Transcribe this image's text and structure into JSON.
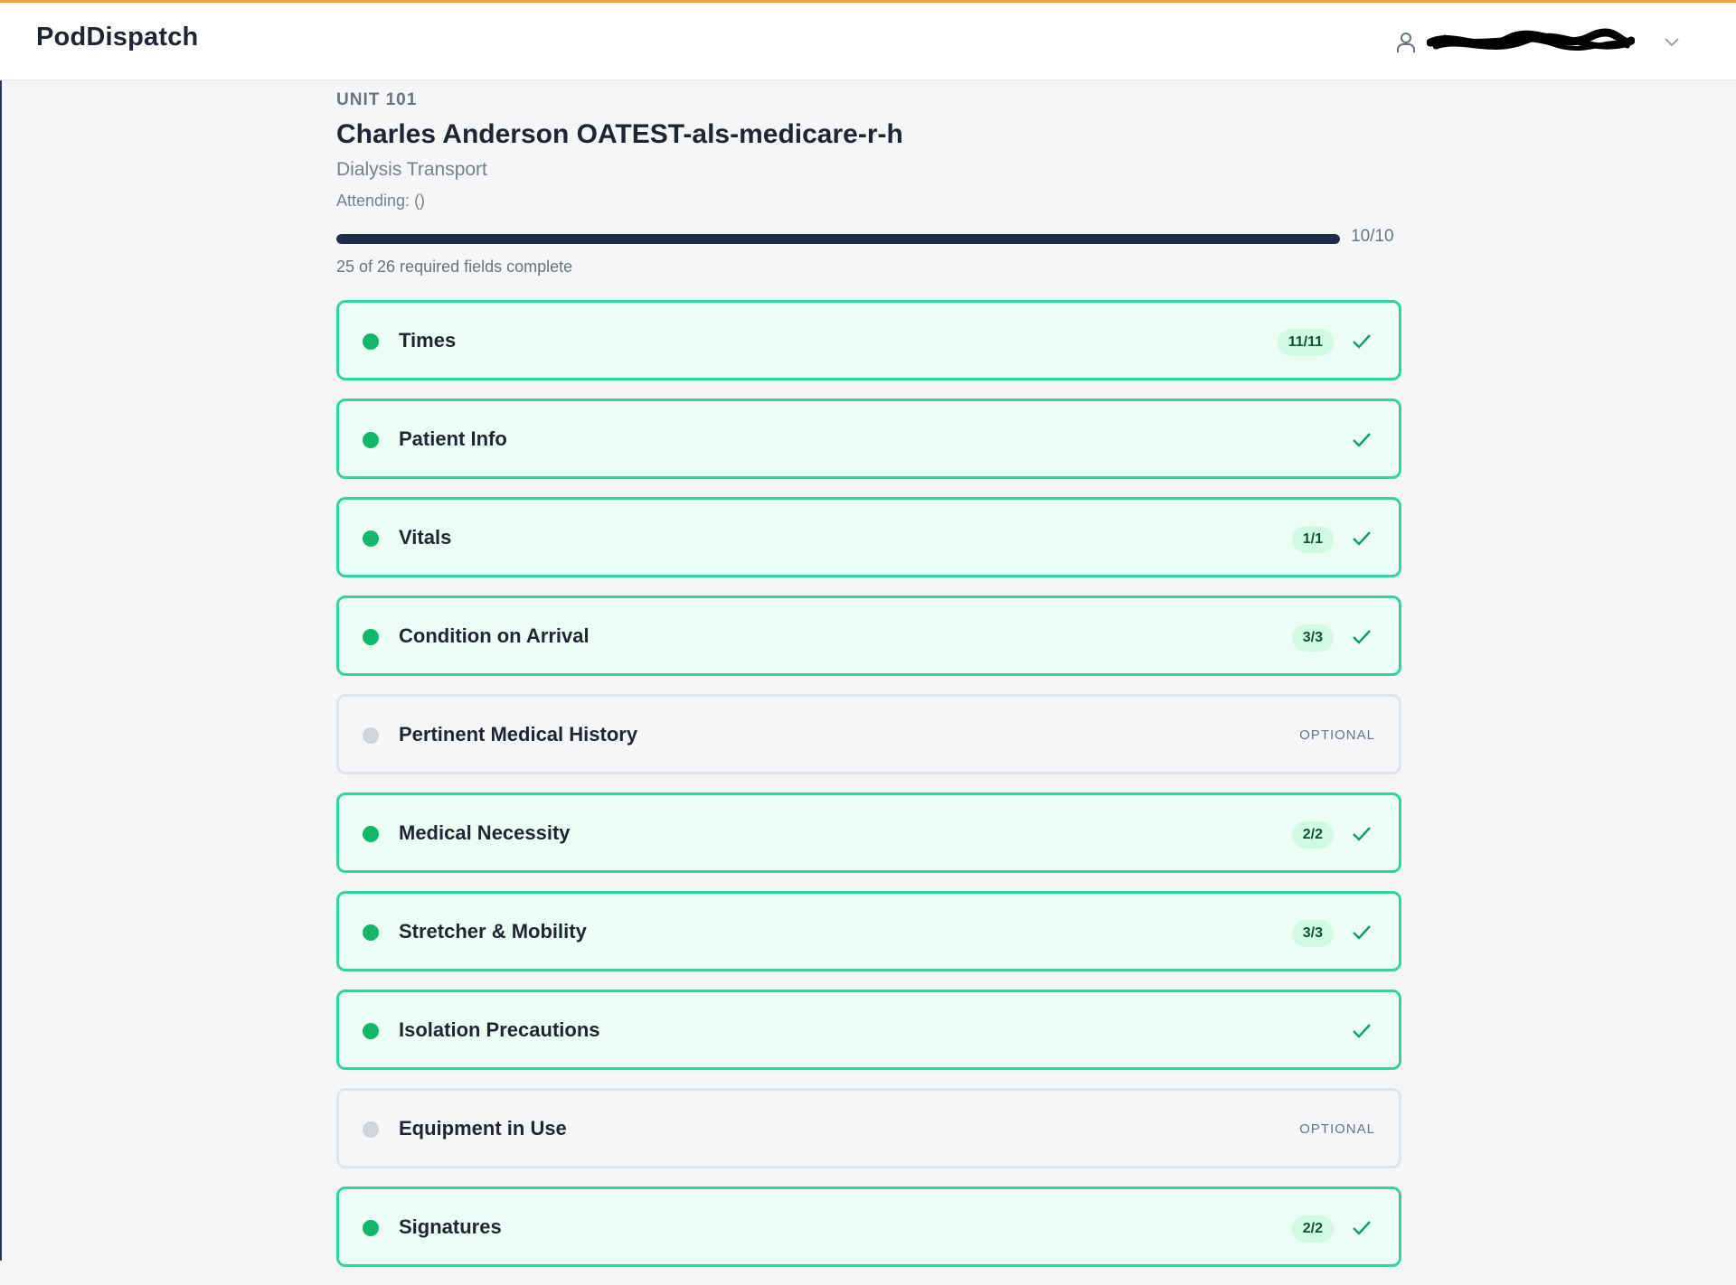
{
  "header": {
    "brand": "PodDispatch"
  },
  "trip": {
    "unit": "UNIT 101",
    "title": "Charles Anderson OATEST-als-medicare-r-h",
    "subtitle": "Dialysis Transport",
    "attending": "Attending: ()"
  },
  "progress": {
    "label": "10/10",
    "fraction": 1.0,
    "required_text": "25 of 26 required fields complete"
  },
  "sections": [
    {
      "label": "Times",
      "badge": "11/11",
      "status": "complete"
    },
    {
      "label": "Patient Info",
      "badge": "",
      "status": "complete"
    },
    {
      "label": "Vitals",
      "badge": "1/1",
      "status": "complete"
    },
    {
      "label": "Condition on Arrival",
      "badge": "3/3",
      "status": "complete"
    },
    {
      "label": "Pertinent Medical History",
      "optional_label": "OPTIONAL",
      "status": "optional"
    },
    {
      "label": "Medical Necessity",
      "badge": "2/2",
      "status": "complete"
    },
    {
      "label": "Stretcher & Mobility",
      "badge": "3/3",
      "status": "complete"
    },
    {
      "label": "Isolation Precautions",
      "badge": "",
      "status": "complete"
    },
    {
      "label": "Equipment in Use",
      "optional_label": "OPTIONAL",
      "status": "optional"
    },
    {
      "label": "Signatures",
      "badge": "2/2",
      "status": "complete"
    }
  ],
  "colors": {
    "accent_top": "#e9a53b",
    "complete_border": "#34d399",
    "complete_bg": "#ecfdf5",
    "progress_fill": "#1b2d4a"
  },
  "icons": {
    "user": "user-icon",
    "chevron": "chevron-down-icon",
    "check": "check-icon"
  }
}
